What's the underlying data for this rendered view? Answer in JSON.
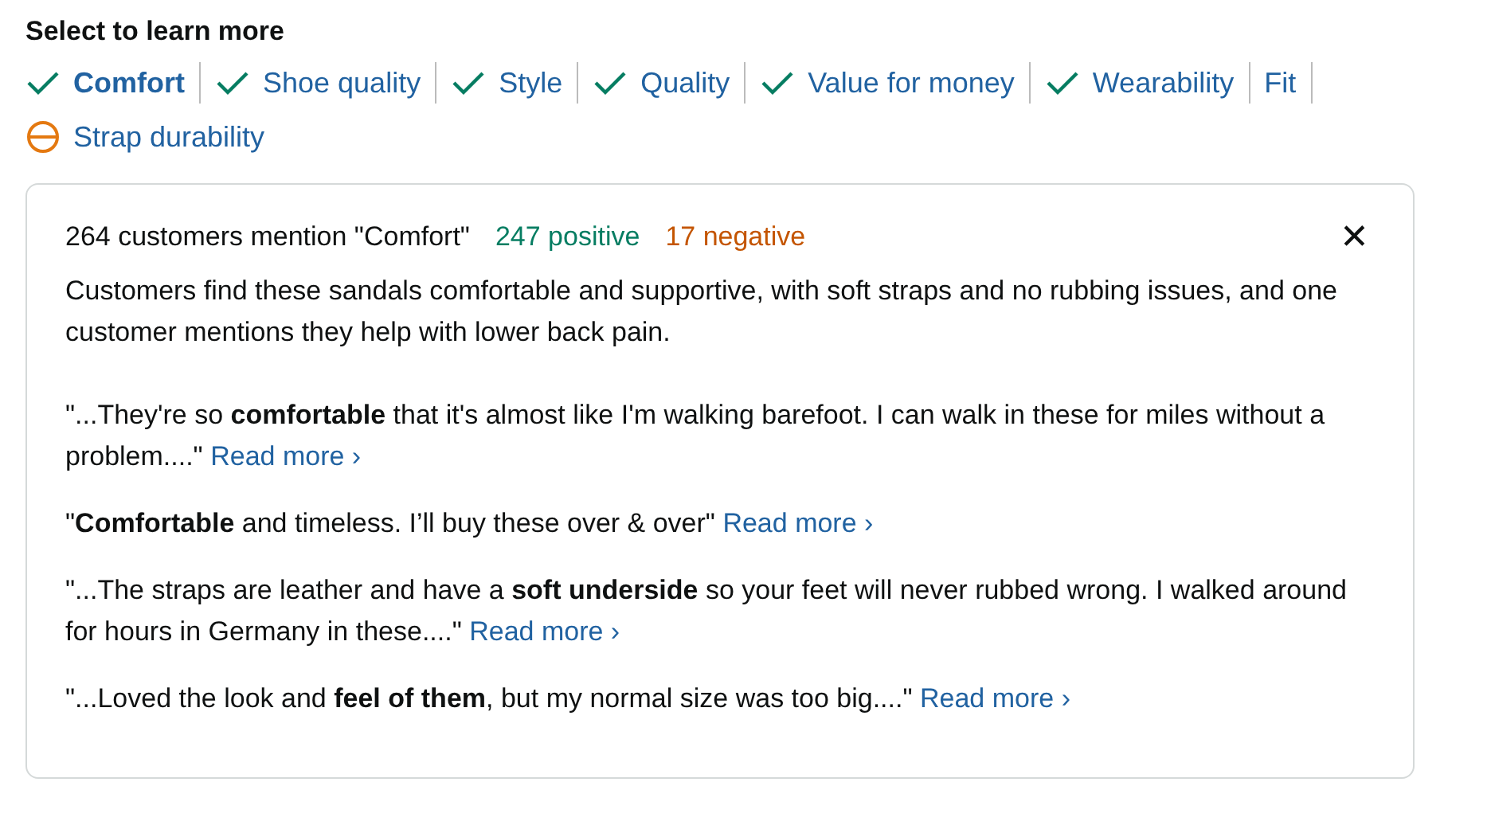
{
  "heading": "Select to learn more",
  "aspects": [
    {
      "label": "Comfort",
      "kind": "positive",
      "selected": true
    },
    {
      "label": "Shoe quality",
      "kind": "positive",
      "selected": false
    },
    {
      "label": "Style",
      "kind": "positive",
      "selected": false
    },
    {
      "label": "Quality",
      "kind": "positive",
      "selected": false
    },
    {
      "label": "Value for money",
      "kind": "positive",
      "selected": false
    },
    {
      "label": "Wearability",
      "kind": "positive",
      "selected": false
    },
    {
      "label": "Fit",
      "kind": "neutral",
      "selected": false
    },
    {
      "label": "Strap durability",
      "kind": "negative",
      "selected": false
    }
  ],
  "panel": {
    "mentions": "264 customers mention \"Comfort\"",
    "positive": "247 positive",
    "negative": "17 negative",
    "close": "✕",
    "summary": "Customers find these sandals comfortable and supportive, with soft straps and no rubbing issues, and one customer mentions they help with lower back pain.",
    "quotes": [
      {
        "text": "\"...They're so **comfortable** that it's almost like I'm walking barefoot. I can walk in these for miles without a problem....\"",
        "link": "Read more ›"
      },
      {
        "text": "\"**Comfortable** and timeless. I’ll buy these over & over\"",
        "link": "Read more ›"
      },
      {
        "text": "\"...The straps are leather and have a **soft underside** so your feet will never rubbed wrong. I walked around for hours in Germany in these....\"",
        "link": "Read more ›"
      },
      {
        "text": "\"...Loved the look and **feel of them**, but my normal size was too big....\"",
        "link": "Read more ›"
      }
    ]
  }
}
